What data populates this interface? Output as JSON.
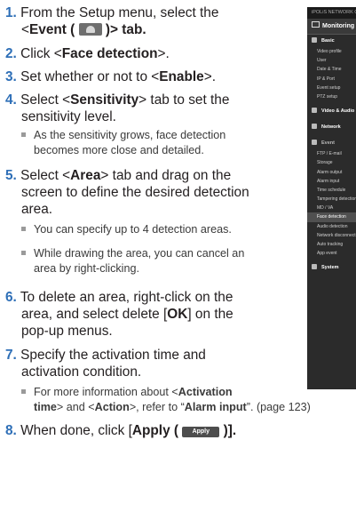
{
  "steps": [
    {
      "num": "1.",
      "a": "From the Setup menu, select the",
      "b1": "<",
      "bold1": "Event (",
      "b2": " )> tab."
    },
    {
      "num": "2.",
      "a": "Click <",
      "bold": "Face detection",
      "c": ">."
    },
    {
      "num": "3.",
      "a": "Set whether or not to <",
      "bold": "Enable",
      "c": ">."
    },
    {
      "num": "4.",
      "a": "Select <",
      "bold": "Sensitivity",
      "c": "> tab to set the",
      "d": "sensitivity level."
    },
    {
      "num": "5.",
      "a": "Select <",
      "bold": "Area",
      "c": "> tab and drag on the",
      "d": "screen to define the desired detection",
      "e": "area."
    },
    {
      "num": "6.",
      "a": "To delete an area, right-click on the",
      "b": "area, and select delete [",
      "bold": "OK",
      "c": "] on the",
      "d": "pop-up menus."
    },
    {
      "num": "7.",
      "a": "Specify the activation time and",
      "b": "activation condition."
    },
    {
      "num": "8.",
      "a": "When done, click [",
      "bold": "Apply (",
      "c": " )]."
    }
  ],
  "bullets": {
    "b4": [
      "As the sensitivity grows, face detection",
      "becomes more close and detailed."
    ],
    "b5a": "You can specify up to 4 detection areas.",
    "b5b": [
      "While drawing the area, you can cancel an",
      "area by right-clicking."
    ],
    "b7": {
      "pre": "For more information about <",
      "bold1": "Activation",
      "bold2": "time",
      "mid": "> and <",
      "bold3": "Action",
      "mid2": ">, refer to “",
      "bold4": "Alarm input",
      "post": "”. (page 123)"
    }
  },
  "apply_button_label": "Apply",
  "panel": {
    "topbar": "iPOLiS NETWORK CAM",
    "header": "Monitoring",
    "sections": {
      "basic": "Basic",
      "video_audio": "Video & Audio",
      "network": "Network",
      "event": "Event",
      "system": "System"
    },
    "basic_items": [
      "Video profile",
      "User",
      "Date & Time",
      "IP & Port",
      "Event setup",
      "PTZ setup"
    ],
    "event_items": [
      "FTP / E-mail",
      "Storage",
      "Alarm output",
      "Alarm input",
      "Time schedule",
      "Tampering detection",
      "MD / VA",
      "Face detection",
      "Audio detection",
      "Network disconnect",
      "Auto tracking",
      "App event"
    ],
    "selected": "Face detection"
  }
}
